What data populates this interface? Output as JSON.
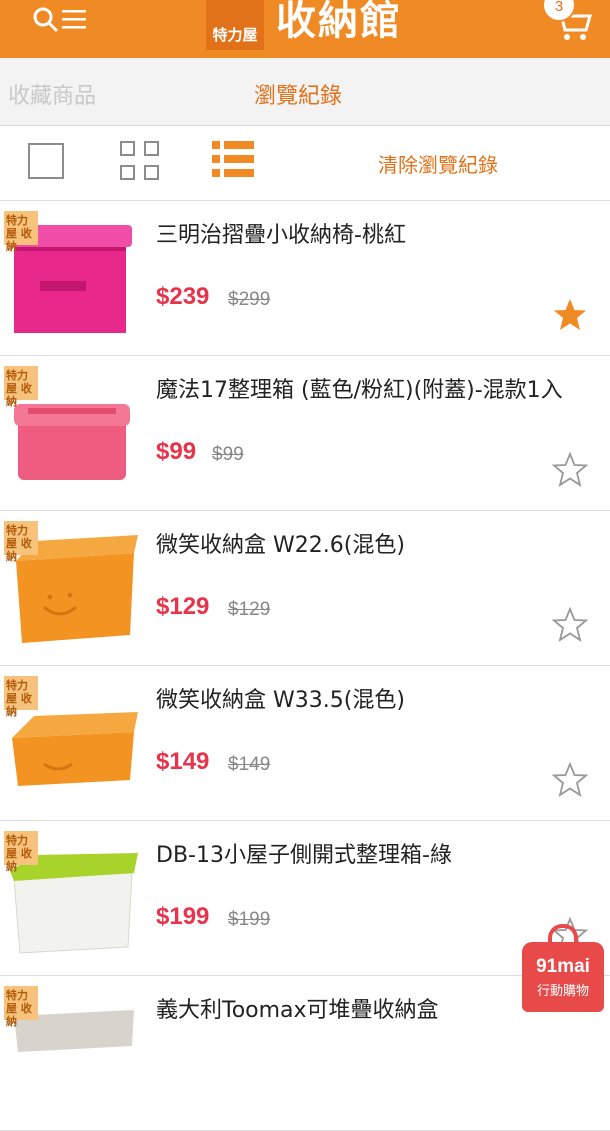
{
  "header": {
    "logo_text": "特力屋",
    "title": "收納館",
    "cart_count": "3",
    "accent_color": "#f08a24"
  },
  "tabs": {
    "favorites_label": "收藏商品",
    "history_label": "瀏覽紀錄"
  },
  "toolbar": {
    "clear_label": "清除瀏覽紀錄",
    "active_view": "list"
  },
  "products": [
    {
      "name": "三明治摺疊小收納椅-桃紅",
      "price": "$239",
      "orig_price": "$299",
      "favorited": true,
      "tag": "特力屋 收納"
    },
    {
      "name": "魔法17整理箱 (藍色/粉紅)(附蓋)-混款1入",
      "price": "$99",
      "orig_price": "$99",
      "favorited": false,
      "tag": "特力屋 收納"
    },
    {
      "name": "微笑收納盒 W22.6(混色)",
      "price": "$129",
      "orig_price": "$129",
      "favorited": false,
      "tag": "特力屋 收納"
    },
    {
      "name": "微笑收納盒 W33.5(混色)",
      "price": "$149",
      "orig_price": "$149",
      "favorited": false,
      "tag": "特力屋 收納"
    },
    {
      "name": "DB-13小屋子側開式整理箱-綠",
      "price": "$199",
      "orig_price": "$199",
      "favorited": false,
      "tag": "特力屋 收納"
    },
    {
      "name": "義大利Toomax可堆疊收納盒",
      "price": "",
      "orig_price": "",
      "favorited": false,
      "tag": "特力屋 收納"
    }
  ],
  "floating_badge": {
    "brand": "91mai",
    "label": "行動購物"
  },
  "icons": [
    "search-icon",
    "menu-icon",
    "cart-icon",
    "star-icon",
    "grid-icon",
    "list-icon",
    "single-view-icon"
  ]
}
